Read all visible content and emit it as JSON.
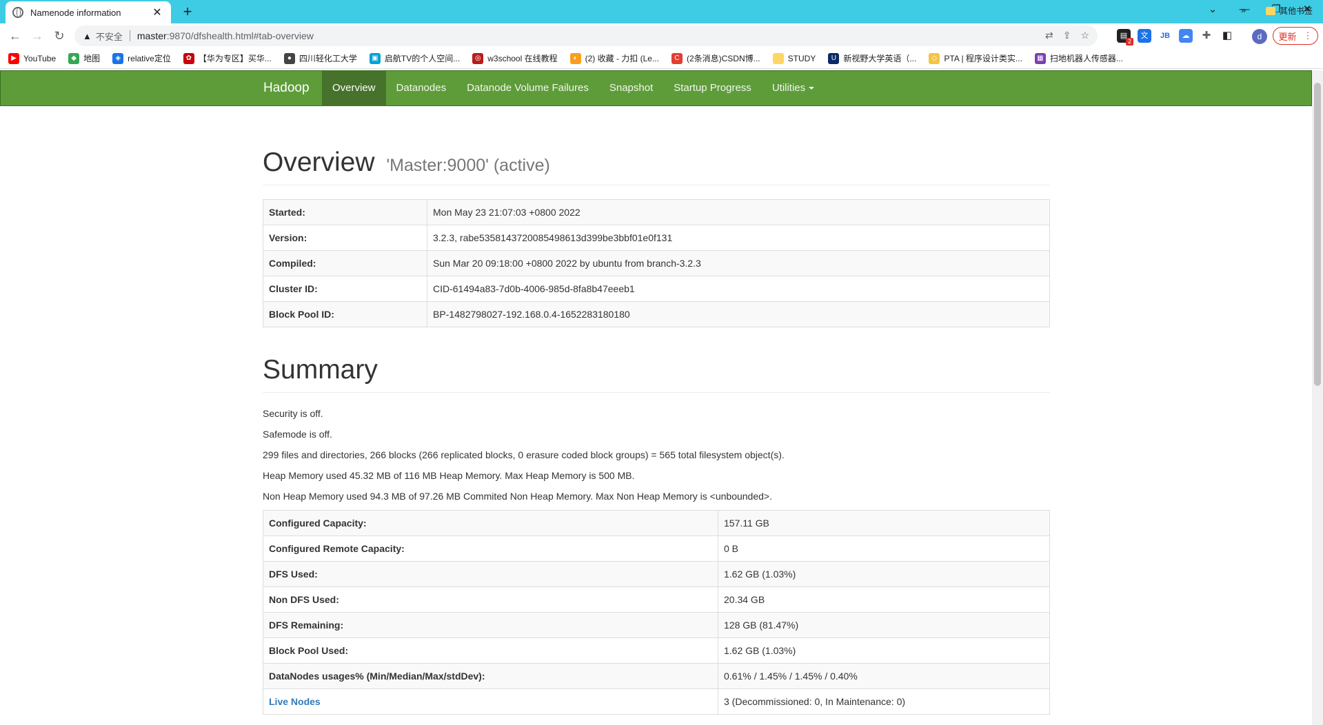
{
  "browser": {
    "tab_title": "Namenode information",
    "insecure_label": "不安全",
    "url_host": "master",
    "url_path": ":9870/dfshealth.html#tab-overview",
    "update_label": "更新",
    "avatar_letter": "d",
    "ext_badge": "2"
  },
  "bookmarks": [
    {
      "label": "YouTube",
      "color": "#ff0000",
      "glyph": "▶"
    },
    {
      "label": "地图",
      "color": "#34a853",
      "glyph": "◆"
    },
    {
      "label": "relative定位",
      "color": "#1a73e8",
      "glyph": "◈"
    },
    {
      "label": "【华为专区】买华...",
      "color": "#c7000b",
      "glyph": "✿"
    },
    {
      "label": "四川轻化工大学",
      "color": "#444444",
      "glyph": "●"
    },
    {
      "label": "启航TV的个人空间...",
      "color": "#00a1d6",
      "glyph": "▣"
    },
    {
      "label": "w3school 在线教程",
      "color": "#b81c1c",
      "glyph": "◎"
    },
    {
      "label": "(2) 收藏 - 力扣 (Le...",
      "color": "#f89f1b",
      "glyph": "◐"
    },
    {
      "label": "(2条消息)CSDN博...",
      "color": "#e33e33",
      "glyph": "C"
    },
    {
      "label": "STUDY",
      "color": "#fdd663",
      "glyph": ""
    },
    {
      "label": "新视野大学英语（...",
      "color": "#0b2a66",
      "glyph": "U"
    },
    {
      "label": "PTA | 程序设计类实...",
      "color": "#f6c343",
      "glyph": "◇"
    },
    {
      "label": "扫地机器人传感器...",
      "color": "#7b3fb0",
      "glyph": "▦"
    }
  ],
  "bookmarks_other": "其他书签",
  "nav": {
    "brand": "Hadoop",
    "items": [
      "Overview",
      "Datanodes",
      "Datanode Volume Failures",
      "Snapshot",
      "Startup Progress",
      "Utilities"
    ]
  },
  "overview": {
    "title": "Overview",
    "subtitle": "'Master:9000' (active)",
    "rows": [
      {
        "label": "Started:",
        "value": "Mon May 23 21:07:03 +0800 2022"
      },
      {
        "label": "Version:",
        "value": "3.2.3, rabe5358143720085498613d399be3bbf01e0f131"
      },
      {
        "label": "Compiled:",
        "value": "Sun Mar 20 09:18:00 +0800 2022 by ubuntu from branch-3.2.3"
      },
      {
        "label": "Cluster ID:",
        "value": "CID-61494a83-7d0b-4006-985d-8fa8b47eeeb1"
      },
      {
        "label": "Block Pool ID:",
        "value": "BP-1482798027-192.168.0.4-1652283180180"
      }
    ]
  },
  "summary": {
    "title": "Summary",
    "lines": [
      "Security is off.",
      "Safemode is off.",
      "299 files and directories, 266 blocks (266 replicated blocks, 0 erasure coded block groups) = 565 total filesystem object(s).",
      "Heap Memory used 45.32 MB of 116 MB Heap Memory. Max Heap Memory is 500 MB.",
      "Non Heap Memory used 94.3 MB of 97.26 MB Commited Non Heap Memory. Max Non Heap Memory is <unbounded>."
    ],
    "rows": [
      {
        "label": "Configured Capacity:",
        "value": "157.11 GB"
      },
      {
        "label": "Configured Remote Capacity:",
        "value": "0 B"
      },
      {
        "label": "DFS Used:",
        "value": "1.62 GB (1.03%)"
      },
      {
        "label": "Non DFS Used:",
        "value": "20.34 GB"
      },
      {
        "label": "DFS Remaining:",
        "value": "128 GB (81.47%)"
      },
      {
        "label": "Block Pool Used:",
        "value": "1.62 GB (1.03%)"
      },
      {
        "label": "DataNodes usages% (Min/Median/Max/stdDev):",
        "value": "0.61% / 1.45% / 1.45% / 0.40%"
      }
    ],
    "live_nodes_label": "Live Nodes",
    "live_nodes_value": "3 (Decommissioned: 0, In Maintenance: 0)"
  }
}
